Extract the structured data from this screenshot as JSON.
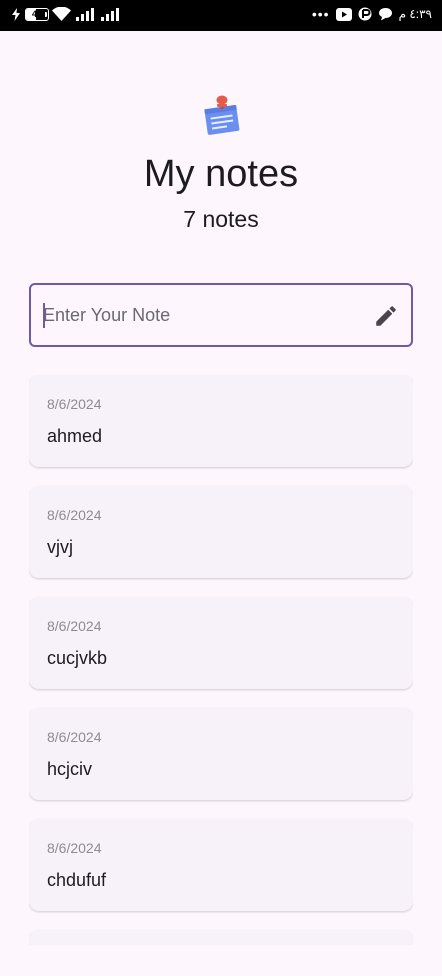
{
  "status_bar": {
    "battery_level": "44",
    "time": "٤:٣٩ م",
    "more_indicator": "•••",
    "icons": [
      "charging-icon",
      "battery-icon",
      "wifi-icon",
      "signal-icon",
      "signal-icon",
      "youtube-icon",
      "app-icon",
      "chat-icon"
    ]
  },
  "header": {
    "title": "My notes",
    "count_label": "7 notes",
    "icon": "note-icon"
  },
  "input": {
    "placeholder": "Enter Your Note",
    "value": "",
    "action_icon": "edit-icon",
    "accent_color": "#6c5ba6"
  },
  "notes": [
    {
      "date": "8/6/2024",
      "text": "ahmed"
    },
    {
      "date": "8/6/2024",
      "text": "vjvj"
    },
    {
      "date": "8/6/2024",
      "text": "cucjvkb"
    },
    {
      "date": "8/6/2024",
      "text": "hcjciv"
    },
    {
      "date": "8/6/2024",
      "text": "chdufuf"
    },
    {
      "date": "",
      "text": ""
    }
  ]
}
